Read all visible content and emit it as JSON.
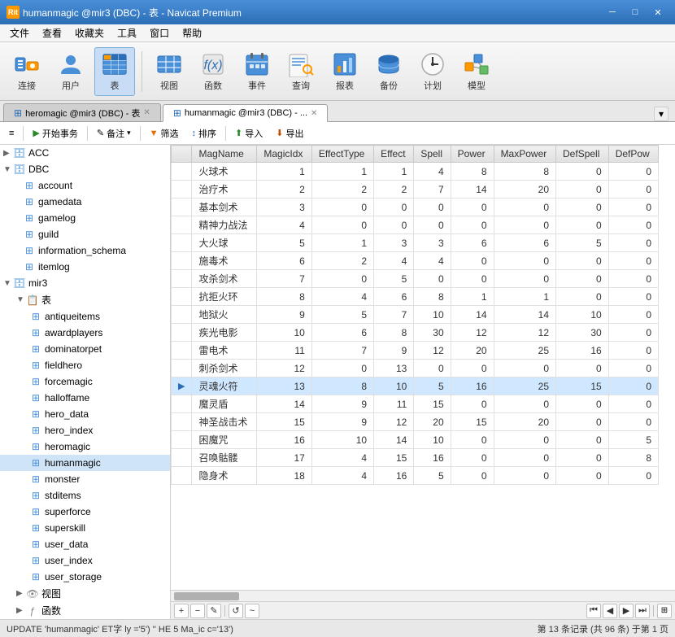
{
  "titleBar": {
    "title": "humanmagic @mir3 (DBC) - 表 - Navicat Premium",
    "icon": "Rit",
    "controls": [
      "minimize",
      "maximize",
      "close"
    ]
  },
  "menuBar": {
    "items": [
      "文件",
      "查看",
      "收藏夹",
      "工具",
      "窗口",
      "帮助"
    ]
  },
  "toolbar": {
    "items": [
      {
        "id": "connect",
        "label": "连接",
        "icon": "connect"
      },
      {
        "id": "user",
        "label": "用户",
        "icon": "user"
      },
      {
        "id": "table",
        "label": "表",
        "icon": "table",
        "active": true
      },
      {
        "id": "view",
        "label": "视图",
        "icon": "view"
      },
      {
        "id": "function",
        "label": "函数",
        "icon": "function"
      },
      {
        "id": "event",
        "label": "事件",
        "icon": "event"
      },
      {
        "id": "query",
        "label": "查询",
        "icon": "query"
      },
      {
        "id": "report",
        "label": "报表",
        "icon": "report"
      },
      {
        "id": "backup",
        "label": "备份",
        "icon": "backup"
      },
      {
        "id": "schedule",
        "label": "计划",
        "icon": "schedule"
      },
      {
        "id": "model",
        "label": "模型",
        "icon": "model"
      }
    ]
  },
  "tabs": [
    {
      "id": "heromagic",
      "label": "heromagic @mir3 (DBC) - 表",
      "active": false
    },
    {
      "id": "humanmagic",
      "label": "humanmagic @mir3 (DBC) - ...",
      "active": true
    }
  ],
  "subToolbar": {
    "buttons": [
      {
        "id": "list-view",
        "icon": "≡",
        "label": ""
      },
      {
        "id": "start-task",
        "label": "开始事务",
        "icon": "▶"
      },
      {
        "id": "annotation",
        "label": "备注 ▾",
        "icon": "📝"
      },
      {
        "id": "filter",
        "label": "筛选",
        "icon": "🔽"
      },
      {
        "id": "sort",
        "label": "排序",
        "icon": "↕"
      },
      {
        "id": "import",
        "label": "导入",
        "icon": "⬆"
      },
      {
        "id": "export",
        "label": "导出",
        "icon": "⬇"
      }
    ]
  },
  "sidebar": {
    "connections": [
      {
        "id": "ACC",
        "label": "ACC",
        "type": "connection",
        "expanded": false,
        "children": []
      },
      {
        "id": "DBC",
        "label": "DBC",
        "type": "connection",
        "expanded": true,
        "children": [
          {
            "id": "account",
            "label": "account",
            "type": "table"
          },
          {
            "id": "gamedata",
            "label": "gamedata",
            "type": "table"
          },
          {
            "id": "gamelog",
            "label": "gamelog",
            "type": "table"
          },
          {
            "id": "guild",
            "label": "guild",
            "type": "table"
          },
          {
            "id": "information_schema",
            "label": "information_schema",
            "type": "table"
          },
          {
            "id": "itemlog",
            "label": "itemlog",
            "type": "table"
          }
        ]
      },
      {
        "id": "mir3",
        "label": "mir3",
        "type": "connection",
        "expanded": true,
        "children": [
          {
            "id": "tables-group",
            "label": "表",
            "type": "group",
            "expanded": true,
            "children": [
              {
                "id": "antiqueitems",
                "label": "antiqueitems",
                "type": "table"
              },
              {
                "id": "awardplayers",
                "label": "awardplayers",
                "type": "table"
              },
              {
                "id": "dominatorpet",
                "label": "dominatorpet",
                "type": "table"
              },
              {
                "id": "fieldhero",
                "label": "fieldhero",
                "type": "table"
              },
              {
                "id": "forcemagic",
                "label": "forcemagic",
                "type": "table"
              },
              {
                "id": "halloffame",
                "label": "halloffame",
                "type": "table"
              },
              {
                "id": "hero_data",
                "label": "hero_data",
                "type": "table"
              },
              {
                "id": "hero_index",
                "label": "hero_index",
                "type": "table"
              },
              {
                "id": "heromagic",
                "label": "heromagic",
                "type": "table"
              },
              {
                "id": "humanmagic",
                "label": "humanmagic",
                "type": "table",
                "selected": true
              },
              {
                "id": "monster",
                "label": "monster",
                "type": "table"
              },
              {
                "id": "stditems",
                "label": "stditems",
                "type": "table"
              },
              {
                "id": "superforce",
                "label": "superforce",
                "type": "table"
              },
              {
                "id": "superskill",
                "label": "superskill",
                "type": "table"
              },
              {
                "id": "user_data",
                "label": "user_data",
                "type": "table"
              },
              {
                "id": "user_index",
                "label": "user_index",
                "type": "table"
              },
              {
                "id": "user_storage",
                "label": "user_storage",
                "type": "table"
              }
            ]
          },
          {
            "id": "views-group",
            "label": "视图",
            "type": "group",
            "expanded": false
          },
          {
            "id": "funcs-group",
            "label": "函数",
            "type": "group",
            "expanded": false
          }
        ]
      }
    ]
  },
  "tableColumns": [
    "MagName",
    "MagicIdx",
    "EffectType",
    "Effect",
    "Spell",
    "Power",
    "MaxPower",
    "DefSpell",
    "DefPow"
  ],
  "tableData": [
    {
      "indicator": "",
      "MagName": "火球术",
      "MagicIdx": "1",
      "EffectType": "1",
      "Effect": "1",
      "Spell": "4",
      "Power": "8",
      "MaxPower": "8",
      "DefSpell": "0",
      "DefPow": "0"
    },
    {
      "indicator": "",
      "MagName": "治疗术",
      "MagicIdx": "2",
      "EffectType": "2",
      "Effect": "2",
      "Spell": "7",
      "Power": "14",
      "MaxPower": "20",
      "DefSpell": "0",
      "DefPow": "0"
    },
    {
      "indicator": "",
      "MagName": "基本剑术",
      "MagicIdx": "3",
      "EffectType": "0",
      "Effect": "0",
      "Spell": "0",
      "Power": "0",
      "MaxPower": "0",
      "DefSpell": "0",
      "DefPow": "0"
    },
    {
      "indicator": "",
      "MagName": "精神力战法",
      "MagicIdx": "4",
      "EffectType": "0",
      "Effect": "0",
      "Spell": "0",
      "Power": "0",
      "MaxPower": "0",
      "DefSpell": "0",
      "DefPow": "0"
    },
    {
      "indicator": "",
      "MagName": "大火球",
      "MagicIdx": "5",
      "EffectType": "1",
      "Effect": "3",
      "Spell": "3",
      "Power": "6",
      "MaxPower": "6",
      "DefSpell": "5",
      "DefPow": "0"
    },
    {
      "indicator": "",
      "MagName": "施毒术",
      "MagicIdx": "6",
      "EffectType": "2",
      "Effect": "4",
      "Spell": "4",
      "Power": "0",
      "MaxPower": "0",
      "DefSpell": "0",
      "DefPow": "0"
    },
    {
      "indicator": "",
      "MagName": "攻杀剑术",
      "MagicIdx": "7",
      "EffectType": "0",
      "Effect": "5",
      "Spell": "0",
      "Power": "0",
      "MaxPower": "0",
      "DefSpell": "0",
      "DefPow": "0"
    },
    {
      "indicator": "",
      "MagName": "抗拒火环",
      "MagicIdx": "8",
      "EffectType": "4",
      "Effect": "6",
      "Spell": "8",
      "Power": "1",
      "MaxPower": "1",
      "DefSpell": "0",
      "DefPow": "0"
    },
    {
      "indicator": "",
      "MagName": "地狱火",
      "MagicIdx": "9",
      "EffectType": "5",
      "Effect": "7",
      "Spell": "10",
      "Power": "14",
      "MaxPower": "14",
      "DefSpell": "10",
      "DefPow": "0"
    },
    {
      "indicator": "",
      "MagName": "疾光电影",
      "MagicIdx": "10",
      "EffectType": "6",
      "Effect": "8",
      "Spell": "30",
      "Power": "12",
      "MaxPower": "12",
      "DefSpell": "30",
      "DefPow": "0"
    },
    {
      "indicator": "",
      "MagName": "雷电术",
      "MagicIdx": "11",
      "EffectType": "7",
      "Effect": "9",
      "Spell": "12",
      "Power": "20",
      "MaxPower": "25",
      "DefSpell": "16",
      "DefPow": "0"
    },
    {
      "indicator": "",
      "MagName": "刺杀剑术",
      "MagicIdx": "12",
      "EffectType": "0",
      "Effect": "13",
      "Spell": "0",
      "Power": "0",
      "MaxPower": "0",
      "DefSpell": "0",
      "DefPow": "0"
    },
    {
      "indicator": "▶",
      "MagName": "灵魂火符",
      "MagicIdx": "13",
      "EffectType": "8",
      "Effect": "10",
      "Spell": "5",
      "Power": "16",
      "MaxPower": "25",
      "DefSpell": "15",
      "DefPow": "0"
    },
    {
      "indicator": "",
      "MagName": "魔灵盾",
      "MagicIdx": "14",
      "EffectType": "9",
      "Effect": "11",
      "Spell": "15",
      "Power": "0",
      "MaxPower": "0",
      "DefSpell": "0",
      "DefPow": "0"
    },
    {
      "indicator": "",
      "MagName": "神圣战击术",
      "MagicIdx": "15",
      "EffectType": "9",
      "Effect": "12",
      "Spell": "20",
      "Power": "15",
      "MaxPower": "20",
      "DefSpell": "0",
      "DefPow": "0"
    },
    {
      "indicator": "",
      "MagName": "困魔咒",
      "MagicIdx": "16",
      "EffectType": "10",
      "Effect": "14",
      "Spell": "10",
      "Power": "0",
      "MaxPower": "0",
      "DefSpell": "0",
      "DefPow": "5"
    },
    {
      "indicator": "",
      "MagName": "召唤骷髅",
      "MagicIdx": "17",
      "EffectType": "4",
      "Effect": "15",
      "Spell": "16",
      "Power": "0",
      "MaxPower": "0",
      "DefSpell": "0",
      "DefPow": "8"
    },
    {
      "indicator": "",
      "MagName": "隐身术",
      "MagicIdx": "18",
      "EffectType": "4",
      "Effect": "16",
      "Spell": "5",
      "Power": "0",
      "MaxPower": "0",
      "DefSpell": "0",
      "DefPow": "0"
    }
  ],
  "statusBar": {
    "sqlText": "UPDATE 'humanmagic' ET字 ly ='5') '' HE 5  Ma_ic c='13')",
    "recordInfo": "第 13 条记录 (共 96 条) 于第 1 页"
  },
  "bottomToolbar": {
    "addBtn": "+",
    "deleteBtn": "−",
    "editBtn": "✎",
    "refreshBtn": "↺",
    "filterBtn": "~",
    "navFirst": "⏮",
    "navPrev": "◀",
    "navNext": "▶",
    "navLast": "⏭"
  }
}
